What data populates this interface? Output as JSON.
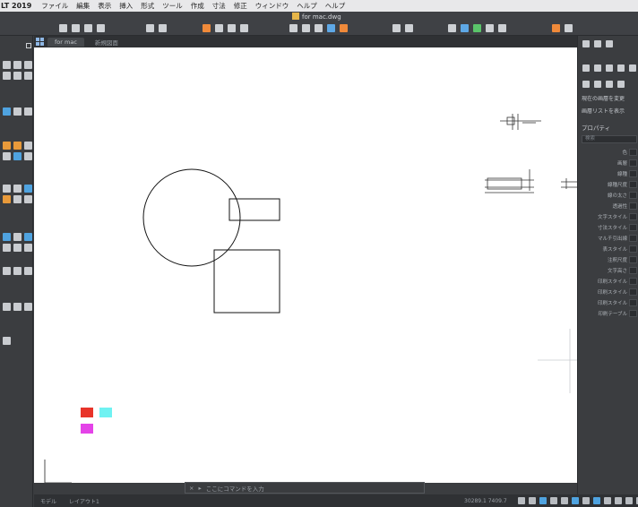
{
  "menubar": {
    "app_name": "LT 2019",
    "items": [
      "ファイル",
      "編集",
      "表示",
      "挿入",
      "形式",
      "ツール",
      "作成",
      "寸法",
      "修正",
      "ウィンドウ",
      "ヘルプ",
      "ヘルプ"
    ]
  },
  "document": {
    "title": "for mac.dwg"
  },
  "tabs": [
    {
      "label": "for mac"
    },
    {
      "label": "新規図面"
    }
  ],
  "right_panel": {
    "layer_label": "現在の画層を変更",
    "layer_list_label": "画層リストを表示",
    "properties_title": "プロパティ",
    "search_placeholder": "検索",
    "properties": [
      "色",
      "画層",
      "線種",
      "線種尺度",
      "線の太さ",
      "透過性",
      "文字スタイル",
      "寸法スタイル",
      "マルチ引出線",
      "表スタイル",
      "注釈尺度",
      "文字高さ",
      "印刷スタイル",
      "印刷スタイル",
      "印刷スタイル",
      "印刷テーブル"
    ]
  },
  "command_line": {
    "placeholder": "ここにコマンドを入力"
  },
  "status_bar": {
    "model_tab": "モデル",
    "layout_tab": "レイアウト1",
    "coords": "30289.1  7409.7"
  },
  "colors": {
    "swatch_red": "#e8342a",
    "swatch_cyan": "#6ff2f2",
    "swatch_magenta": "#e443e8"
  }
}
